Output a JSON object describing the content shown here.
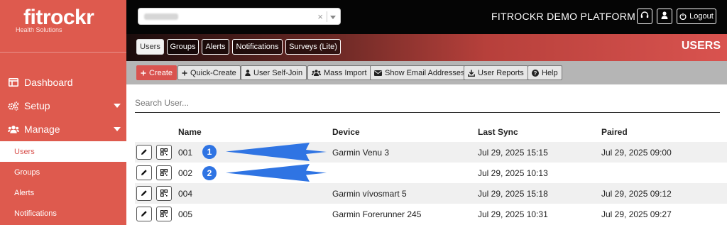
{
  "brand": {
    "name": "fitrockr",
    "tagline": "Health Solutions"
  },
  "sidebar": {
    "items": [
      {
        "label": "Dashboard",
        "icon": "dashboard-icon"
      },
      {
        "label": "Setup",
        "icon": "cogs-icon"
      },
      {
        "label": "Manage",
        "icon": "users-icon"
      }
    ],
    "subitems": [
      {
        "label": "Users",
        "active": true
      },
      {
        "label": "Groups"
      },
      {
        "label": "Alerts"
      },
      {
        "label": "Notifications"
      }
    ]
  },
  "header": {
    "platform_title": "FITROCKR DEMO PLATFORM",
    "logout_label": "Logout",
    "tenant_clear": "×"
  },
  "tabs": [
    "Users",
    "Groups",
    "Alerts",
    "Notifications",
    "Surveys (Lite)"
  ],
  "section_title": "USERS",
  "toolbar": {
    "create": "Create",
    "quick_create": "Quick-Create",
    "self_join": "User Self-Join",
    "mass_import": "Mass Import",
    "show_email": "Show Email Addresses",
    "user_reports": "User Reports",
    "help": "Help"
  },
  "search": {
    "placeholder": "Search User..."
  },
  "table": {
    "columns": [
      "Name",
      "Device",
      "Last Sync",
      "Paired"
    ],
    "rows": [
      {
        "name": "001",
        "device": "Garmin Venu 3",
        "last_sync": "Jul 29, 2025 15:15",
        "paired": "Jul 29, 2025 09:00"
      },
      {
        "name": "002",
        "device": "",
        "last_sync": "Jul 29, 2025 10:13",
        "paired": ""
      },
      {
        "name": "004",
        "device": "Garmin vívosmart 5",
        "last_sync": "Jul 29, 2025 15:18",
        "paired": "Jul 29, 2025 09:12"
      },
      {
        "name": "005",
        "device": "Garmin Forerunner 245",
        "last_sync": "Jul 29, 2025 10:31",
        "paired": "Jul 29, 2025 09:27"
      }
    ]
  },
  "annotations": {
    "badge1": "1",
    "badge2": "2",
    "color": "#2f74e3"
  },
  "colors": {
    "brand_red": "#de5a4e",
    "header_black": "#050505",
    "annotation_blue": "#2f74e3"
  }
}
